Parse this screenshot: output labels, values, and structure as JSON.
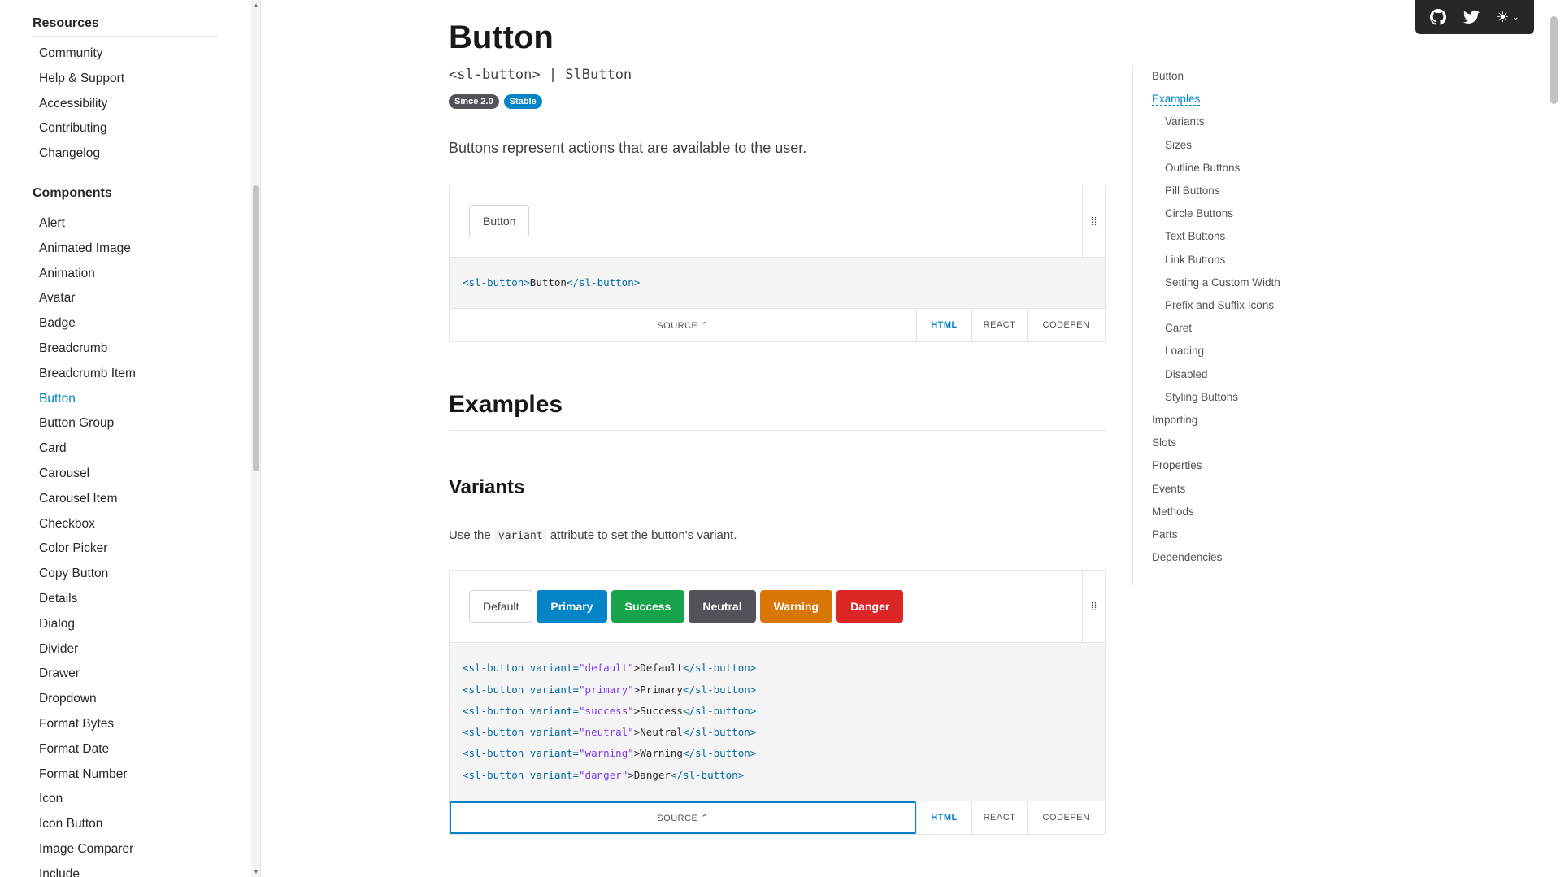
{
  "sidebar": {
    "sections": [
      {
        "heading": "Resources",
        "items": [
          "Community",
          "Help & Support",
          "Accessibility",
          "Contributing",
          "Changelog"
        ]
      },
      {
        "heading": "Components",
        "items": [
          "Alert",
          "Animated Image",
          "Animation",
          "Avatar",
          "Badge",
          "Breadcrumb",
          "Breadcrumb Item",
          "Button",
          "Button Group",
          "Card",
          "Carousel",
          "Carousel Item",
          "Checkbox",
          "Color Picker",
          "Copy Button",
          "Details",
          "Dialog",
          "Divider",
          "Drawer",
          "Dropdown",
          "Format Bytes",
          "Format Date",
          "Format Number",
          "Icon",
          "Icon Button",
          "Image Comparer",
          "Include"
        ]
      }
    ],
    "active_item": "Button"
  },
  "page": {
    "title": "Button",
    "tag": "<sl-button> | SlButton",
    "badges": [
      "Since 2.0",
      "Stable"
    ],
    "intro": "Buttons represent actions that are available to the user."
  },
  "example1": {
    "button_label": "Button",
    "code": {
      "open_tag": "<sl-button>",
      "text": "Button",
      "close_tag": "</sl-button>"
    }
  },
  "toolbar": {
    "source": "SOURCE ⌃",
    "html": "HTML",
    "react": "REACT",
    "codepen": "CODEPEN"
  },
  "examples_heading": "Examples",
  "variants": {
    "heading": "Variants",
    "para_before": "Use the",
    "para_code": "variant",
    "para_after": "attribute to set the button's variant.",
    "buttons": [
      "Default",
      "Primary",
      "Success",
      "Neutral",
      "Warning",
      "Danger"
    ],
    "code_lines": [
      {
        "value": "default",
        "text": "Default"
      },
      {
        "value": "primary",
        "text": "Primary"
      },
      {
        "value": "success",
        "text": "Success"
      },
      {
        "value": "neutral",
        "text": "Neutral"
      },
      {
        "value": "warning",
        "text": "Warning"
      },
      {
        "value": "danger",
        "text": "Danger"
      }
    ]
  },
  "toc": {
    "items": [
      {
        "label": "Button",
        "level": 1
      },
      {
        "label": "Examples",
        "level": 1,
        "active": true
      },
      {
        "label": "Variants",
        "level": 2
      },
      {
        "label": "Sizes",
        "level": 2
      },
      {
        "label": "Outline Buttons",
        "level": 2
      },
      {
        "label": "Pill Buttons",
        "level": 2
      },
      {
        "label": "Circle Buttons",
        "level": 2
      },
      {
        "label": "Text Buttons",
        "level": 2
      },
      {
        "label": "Link Buttons",
        "level": 2
      },
      {
        "label": "Setting a Custom Width",
        "level": 2
      },
      {
        "label": "Prefix and Suffix Icons",
        "level": 2
      },
      {
        "label": "Caret",
        "level": 2
      },
      {
        "label": "Loading",
        "level": 2
      },
      {
        "label": "Disabled",
        "level": 2
      },
      {
        "label": "Styling Buttons",
        "level": 2
      },
      {
        "label": "Importing",
        "level": 1
      },
      {
        "label": "Slots",
        "level": 1
      },
      {
        "label": "Properties",
        "level": 1
      },
      {
        "label": "Events",
        "level": 1
      },
      {
        "label": "Methods",
        "level": 1
      },
      {
        "label": "Parts",
        "level": 1
      },
      {
        "label": "Dependencies",
        "level": 1
      }
    ]
  },
  "top_tools": {
    "icons": [
      "github-icon",
      "twitter-icon",
      "sun-icon"
    ]
  },
  "colors": {
    "primary": "#0284c7",
    "success": "#16a34a",
    "neutral": "#52525b",
    "warning": "#d97706",
    "danger": "#dc2626"
  }
}
